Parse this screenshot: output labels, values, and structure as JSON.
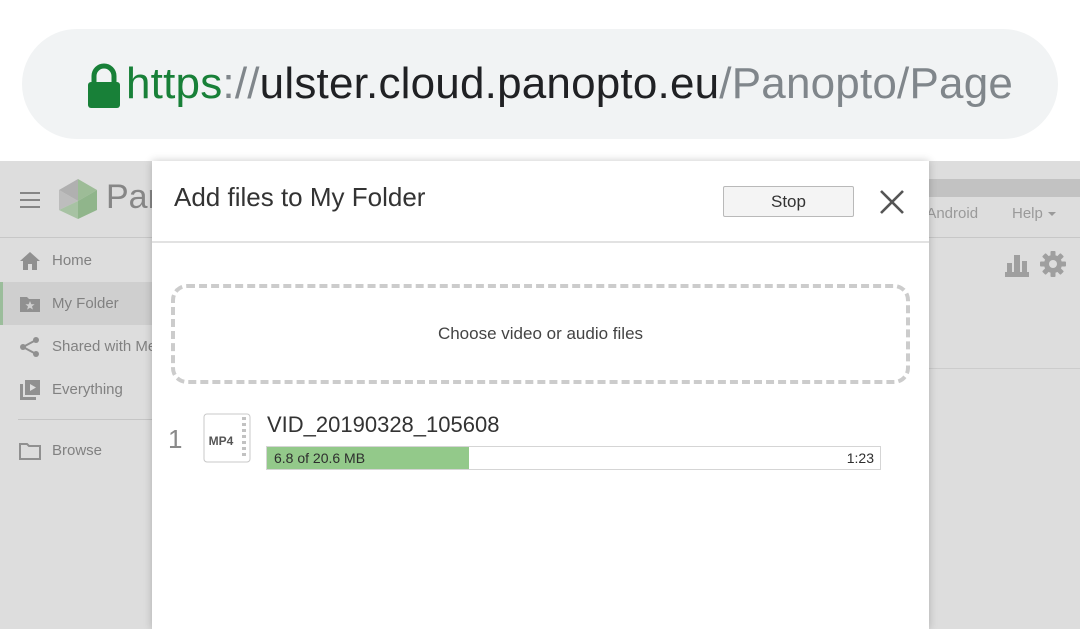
{
  "browser": {
    "url": {
      "scheme": "https",
      "separator": "://",
      "host": "ulster.cloud.panopto.eu",
      "path": "/Panopto/Page"
    },
    "lock_icon": "lock-icon",
    "colors": {
      "secure": "#188038",
      "host": "#202124",
      "dim": "#80868b"
    }
  },
  "app": {
    "logo_text": "Par",
    "header_links": {
      "android": "r Android",
      "help": "Help"
    },
    "sidebar": {
      "items": [
        {
          "label": "Home",
          "icon": "home-icon"
        },
        {
          "label": "My Folder",
          "icon": "starred-folder-icon",
          "active": true
        },
        {
          "label": "Shared with Me",
          "icon": "share-icon"
        },
        {
          "label": "Everything",
          "icon": "video-library-icon"
        },
        {
          "label": "Browse",
          "icon": "folder-icon"
        }
      ]
    }
  },
  "modal": {
    "title": "Add files to My Folder",
    "stop_label": "Stop",
    "dropzone_label": "Choose video or audio files",
    "files": [
      {
        "index": "1",
        "type_badge": "MP4",
        "name": "VID_20190328_105608",
        "progress_text": "6.8 of 20.6 MB",
        "time_remaining": "1:23",
        "progress_fraction": 0.33
      }
    ],
    "colors": {
      "progress_fill": "#93c98a"
    }
  }
}
